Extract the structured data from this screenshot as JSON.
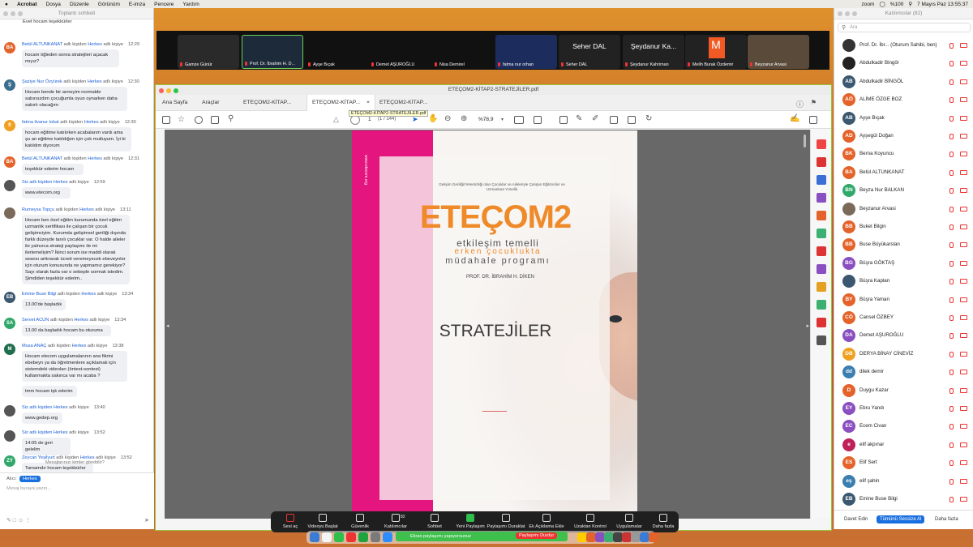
{
  "menubar": {
    "apple": "",
    "app": "Acrobat",
    "items": [
      "Dosya",
      "Düzenle",
      "Görünüm",
      "E-imza",
      "Pencere",
      "Yardım"
    ],
    "zoom": "zoom",
    "battery": "%100",
    "datetime": "7 Mayıs Paz  13:55:37"
  },
  "chat": {
    "title": "Toplantı sohbeti",
    "top_message": "Evet hocam teşekkürler",
    "messages": [
      {
        "initials": "BA",
        "color": "#e4632a",
        "sender": "Betül ALTUNKANAT",
        "mid": "adlı kişiden",
        "to": "Herkes",
        "tail": "adlı kişiye",
        "time": "12:29",
        "text": "hocam öğleden sonra stratejileri açacak mıyız?"
      },
      {
        "initials": "Ş",
        "color": "#3b6f8f",
        "sender": "Şaziye Nur Özyürek",
        "mid": "adlı kişiden",
        "to": "Herkes",
        "tail": "adlı kişiye",
        "time": "12:30",
        "text": "Hocam bende bir anneyim normalde sabırsızdım çocuğumla oyun oynarken daha sabırlı olacağım"
      },
      {
        "initials": "fl",
        "color": "#f0a020",
        "sender": "fatma livanur tokat",
        "mid": "adlı kişiden",
        "to": "Herkes",
        "tail": "adlı kişiye",
        "time": "12:30",
        "text": "hocam eğitime katılırken acabalarım vardı ama şu an eğitime katıldığım için çok mutluyum. İyi ki katıldım diyorum"
      },
      {
        "initials": "BA",
        "color": "#e4632a",
        "sender": "Betül ALTUNKANAT",
        "mid": "adlı kişiden",
        "to": "Herkes",
        "tail": "adlı kişiye",
        "time": "12:31",
        "text": "teşekkür ederim hocam"
      },
      {
        "initials": "",
        "color": "#555555",
        "sender": "Siz adlı kişiden",
        "mid": "",
        "to": "Herkes",
        "tail": "adlı kişiye",
        "time": "12:59",
        "text": "www.etecom.org"
      },
      {
        "initials": "",
        "color": "#7a6a5a",
        "sender": "Rumeysa Topçu",
        "mid": "adlı kişiden",
        "to": "Herkes",
        "tail": "adlı kişiye",
        "time": "13:11",
        "text": "Hocam ben özel eğitim kurumunda özel eğitim uzmanlık sertifikası ile çalışan bir çocuk gelişimciyim. Kurumda gelişimsel geriliği dışında farklı düzeyde tanılı çocuklar var. O halde aileler ile yalnızca strateji paylaşımı ile mi ilerlemeliyim? İkinci sorum ise maddi olarak seansı arttırarak ücreti veremeyecek ebeveynler için oturum konusunda ne yapmamız gerekiyor? Sayı olarak fazla var o sebeple sormak istedim. Şimdiden teşekkür ederim.."
      },
      {
        "initials": "EB",
        "color": "#3b5870",
        "sender": "Emine Buse Bilgi",
        "mid": "adlı kişiden",
        "to": "Herkes",
        "tail": "adlı kişiye",
        "time": "13:34",
        "text": "13.00'de başladık"
      },
      {
        "initials": "SA",
        "color": "#2fa86a",
        "sender": "Servet ACUN",
        "mid": "adlı kişiden",
        "to": "Herkes",
        "tail": "adlı kişiye",
        "time": "13:34",
        "text": "13.00 da başladık hocam bu oturuma"
      },
      {
        "initials": "M",
        "color": "#1f6f4f",
        "sender": "Musa ANAÇ",
        "mid": "adlı kişiden",
        "to": "Herkes",
        "tail": "adlı kişiye",
        "time": "13:38",
        "text": "Hocam etecom uygulamalarının ana fikrini ebebeyn ya da öğretmenlere açıklamak için sistemdeki videoları (öntest-sontest) kullanmakta sakınca var mı acaba ?"
      },
      {
        "initials": "",
        "color": "#1f6f4f",
        "sender": "",
        "mid": "",
        "to": "",
        "tail": "",
        "time": "",
        "text": "tmm hocam tşk ederim"
      },
      {
        "initials": "",
        "color": "#555555",
        "sender": "Siz adlı kişiden",
        "mid": "",
        "to": "Herkes",
        "tail": "adlı kişiye",
        "time": "13:40",
        "text": "www.gedep.org"
      },
      {
        "initials": "",
        "color": "#555555",
        "sender": "Siz adlı kişiden",
        "mid": "",
        "to": "Herkes",
        "tail": "adlı kişiye",
        "time": "13:52",
        "text": "14:05 de geri gelelim"
      },
      {
        "initials": "ZY",
        "color": "#2fa86a",
        "sender": "Zeycan Yeşilyurt",
        "mid": "adlı kişiden",
        "to": "Herkes",
        "tail": "adlı kişiye",
        "time": "13:52",
        "text": "Tamamdır hocam teşekkürler"
      }
    ],
    "who_can_see": "Mesajlarınızı kimler görebilir?",
    "to_label": "Alıcı:",
    "to_value": "Herkes",
    "input_placeholder": "Mesaj buraya yazın..."
  },
  "video_strip": [
    {
      "name": "Gamze Günür",
      "big": ""
    },
    {
      "name": "Prof. Dr. İbrahim H. D...",
      "big": ""
    },
    {
      "name": "Ayşe Bıçak",
      "big": ""
    },
    {
      "name": "Demet AŞUROĞLU",
      "big": ""
    },
    {
      "name": "Nisa Demirel",
      "big": ""
    },
    {
      "name": "fatma nur orhan",
      "big": ""
    },
    {
      "name": "Seher DAL",
      "big": "Seher DAL"
    },
    {
      "name": "Şeydanur Kahriman",
      "big": "Şeydanur Ka..."
    },
    {
      "name": "Melih Burak Özdemir",
      "big": "M"
    },
    {
      "name": "Beyzanur Arvasi",
      "big": ""
    }
  ],
  "acrobat": {
    "window_title": "ETEÇOM2-KİTAP2-STRATEJİLER.pdf",
    "nav": [
      "Ana Sayfa",
      "Araçlar"
    ],
    "tabs": [
      "ETEÇOM2-KİTAP...",
      "ETEÇOM2-KİTAP...",
      "ETEÇOM2-KİTAP..."
    ],
    "tooltip": "ETEÇOM2-KİTAP2-STRATEJİLER.pdf",
    "page_indicator": "(1 / 144)",
    "page_number": "1",
    "zoom": "%78,9"
  },
  "pdf_page": {
    "vertical_text": "www.etecom.org",
    "subtitle": "Gelişim Geriliği/Yetersizliği olan Çocuklar ve Aileleriyle Çalışan Eğitimciler ve Uzmanlara Yönelik",
    "logo": "ETEÇOM2",
    "tag1": "etkileşim temelli",
    "tag2": "erken çocuklukta",
    "tag3": "müdahale programı",
    "author": "PROF. DR. İBRAHİM H. DİKEN",
    "title": "STRATEJİLER"
  },
  "participants": {
    "title": "Katılımcılar (82)",
    "search_placeholder": "Ara",
    "list": [
      {
        "initials": "",
        "color": "#333333",
        "name": "Prof. Dr. İbr...    (Oturum Sahibi, ben)"
      },
      {
        "initials": "",
        "color": "#222222",
        "name": "Abdulkadir Bingöl"
      },
      {
        "initials": "AB",
        "color": "#3b5870",
        "name": "Abdulkadir BİNGÖL"
      },
      {
        "initials": "AÖ",
        "color": "#e4632a",
        "name": "ALİME ÖZGE BOZ"
      },
      {
        "initials": "AB",
        "color": "#3b5870",
        "name": "Ayşe Bıçak"
      },
      {
        "initials": "AD",
        "color": "#e4632a",
        "name": "Ayşegül Doğan"
      },
      {
        "initials": "BK",
        "color": "#e4632a",
        "name": "Berna Koyuncu"
      },
      {
        "initials": "BA",
        "color": "#e4632a",
        "name": "Betül ALTUNKANAT"
      },
      {
        "initials": "BN",
        "color": "#2fa86a",
        "name": "Beyza Nur BALKAN"
      },
      {
        "initials": "",
        "color": "#7a6a5a",
        "name": "Beyzanur Arvasi"
      },
      {
        "initials": "BB",
        "color": "#e4632a",
        "name": "Buket Bilgin"
      },
      {
        "initials": "BB",
        "color": "#e4632a",
        "name": "Buse Büyükarslan"
      },
      {
        "initials": "BG",
        "color": "#8a4fc0",
        "name": "Büşra GÖKTAŞ"
      },
      {
        "initials": "",
        "color": "#3b5870",
        "name": "Büşra Kaplan"
      },
      {
        "initials": "BY",
        "color": "#e4632a",
        "name": "Büşra Yaman"
      },
      {
        "initials": "CÖ",
        "color": "#e4632a",
        "name": "Cansel ÖZBEY"
      },
      {
        "initials": "DA",
        "color": "#8a4fc0",
        "name": "Demet AŞUROĞLU"
      },
      {
        "initials": "DB",
        "color": "#f0a020",
        "name": "DERYA BİNAY CİNEVİZ"
      },
      {
        "initials": "dd",
        "color": "#3b7fb0",
        "name": "dilek demir"
      },
      {
        "initials": "D",
        "color": "#e4632a",
        "name": "Duygu Kazar"
      },
      {
        "initials": "EY",
        "color": "#8a4fc0",
        "name": "Ebru Yandı"
      },
      {
        "initials": "EC",
        "color": "#8a4fc0",
        "name": "Ecem Civan"
      },
      {
        "initials": "e",
        "color": "#c0205a",
        "name": "elif akpınar"
      },
      {
        "initials": "ES",
        "color": "#e4632a",
        "name": "Elif Sert"
      },
      {
        "initials": "eş",
        "color": "#3b7fb0",
        "name": "elif şahin"
      },
      {
        "initials": "EB",
        "color": "#3b5870",
        "name": "Emine Buse Bilgi"
      }
    ],
    "invite": "Davet Edin",
    "mute_all": "Tümünü Sessize Al",
    "more": "Daha fazla"
  },
  "controls": [
    {
      "label": "Sesi aç"
    },
    {
      "label": "Videoyu Başlat"
    },
    {
      "label": "Güvenlik"
    },
    {
      "label": "Katılımcılar",
      "count": "82"
    },
    {
      "label": "Sohbet"
    },
    {
      "label": "Yeni Paylaşım"
    },
    {
      "label": "Paylaşımı Duraklat"
    },
    {
      "label": "Ek Açıklama Ekle"
    },
    {
      "label": "Uzaktan Kontrol"
    },
    {
      "label": "Uygulamalar"
    },
    {
      "label": "Daha fazla"
    }
  ],
  "share_bar": {
    "status": "Ekran paylaşımı yapıyorsunuz",
    "stop": "Paylaşımı Durdur"
  },
  "colors": {
    "brand_pink": "#e5157f",
    "brand_orange": "#ef8a2a",
    "link_blue": "#1a5fd6",
    "share_green": "#3fbf4c"
  }
}
